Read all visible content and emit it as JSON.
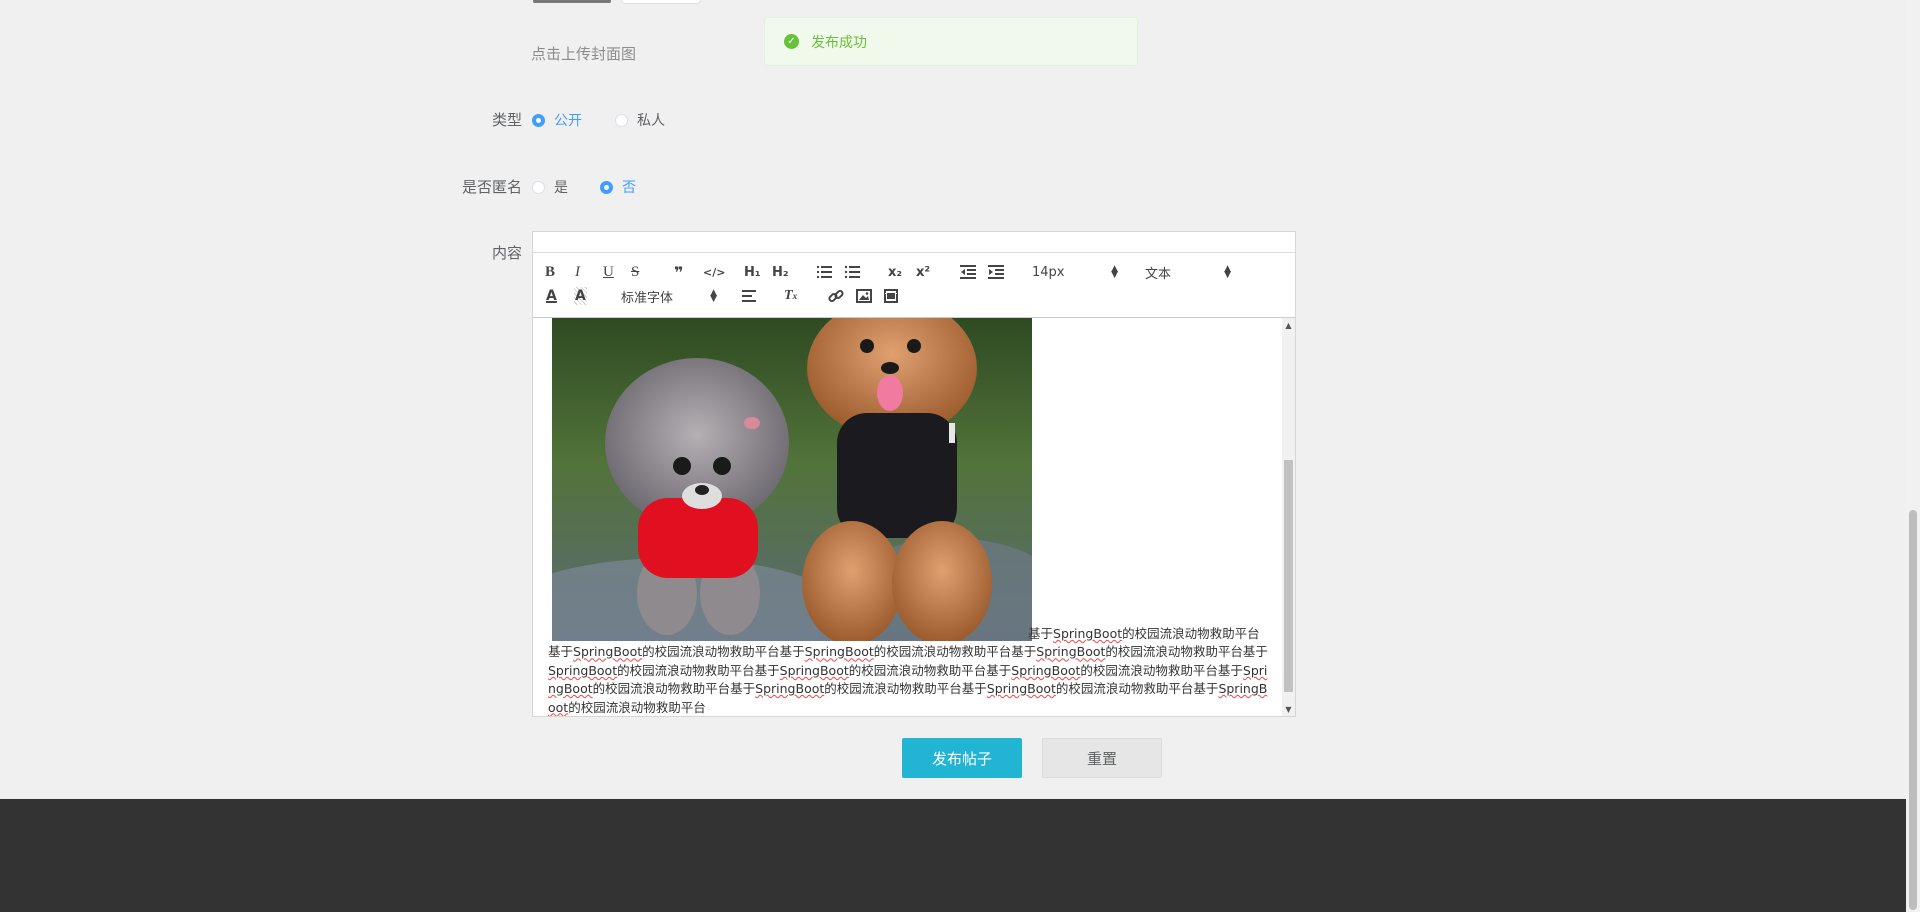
{
  "upload": {
    "hint": "点击上传封面图"
  },
  "toast": {
    "message": "发布成功"
  },
  "form": {
    "type_label": "类型",
    "type_options": [
      {
        "label": "公开",
        "checked": true
      },
      {
        "label": "私人",
        "checked": false
      }
    ],
    "anonymous_label": "是否匿名",
    "anonymous_options": [
      {
        "label": "是",
        "checked": false
      },
      {
        "label": "否",
        "checked": true
      }
    ],
    "content_label": "内容"
  },
  "editor": {
    "size_picker": "14px",
    "header_picker": "文本",
    "font_picker": "标准字体",
    "text_segments": [
      "基于",
      "SpringBoot",
      "的校园流浪动物救助平台基于",
      "SpringBoot",
      "的校园流浪动物救助平台基于",
      "SpringBoot",
      "的校园流浪动物救助平台基于",
      "SpringBoot",
      "的校园流浪动物救助平台基于",
      "SpringBoot",
      "的校园流浪动物救助平台基于",
      "SpringBoot",
      "的校园流浪动物救助平台基于",
      "SpringBoot",
      "的校园流浪动物救助平台基于",
      "SpringBoot",
      "的校园流浪动物救助平台基于",
      "SpringBoot",
      "的校园流浪动物救助平台基于",
      "SpringBoot",
      "的校园流浪动物救助平台基于",
      "SpringBoot",
      "的校园流浪动物救助平台"
    ]
  },
  "buttons": {
    "publish": "发布帖子",
    "reset": "重置"
  },
  "colors": {
    "primary": "#22b4d3",
    "success": "#67c23a",
    "radio_active": "#409eff",
    "footer": "#333333"
  }
}
